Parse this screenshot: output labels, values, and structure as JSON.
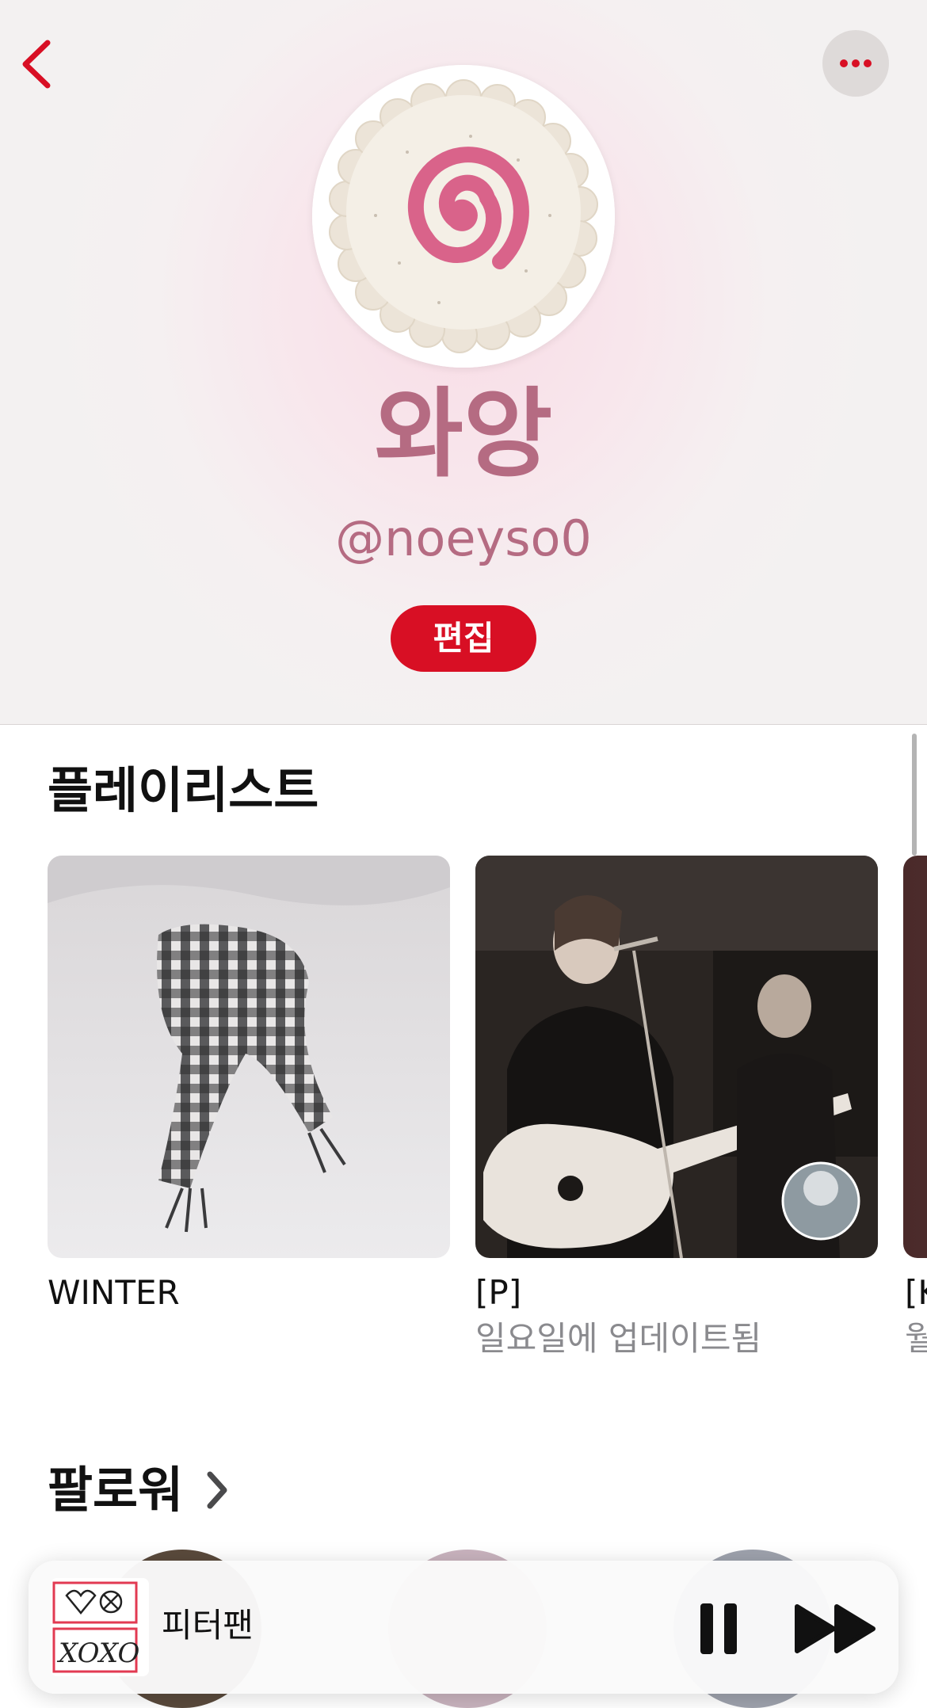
{
  "header": {
    "display_name": "와앙",
    "username": "@noeyso0",
    "edit_label": "편집"
  },
  "playlists": {
    "title": "플레이리스트",
    "items": [
      {
        "title": "WINTER",
        "subtitle": ""
      },
      {
        "title": "[P]",
        "subtitle": "일요일에 업데이트됨"
      },
      {
        "title": "[K",
        "subtitle": "월"
      }
    ]
  },
  "followers": {
    "title": "팔로워"
  },
  "now_playing": {
    "title": "피터팬"
  },
  "colors": {
    "accent": "#d80f24",
    "name_color": "#b56b82"
  },
  "icons": {
    "back": "chevron-left-icon",
    "more": "ellipsis-icon",
    "followers_chevron": "chevron-right-icon",
    "pause": "pause-icon",
    "next": "forward-icon"
  }
}
